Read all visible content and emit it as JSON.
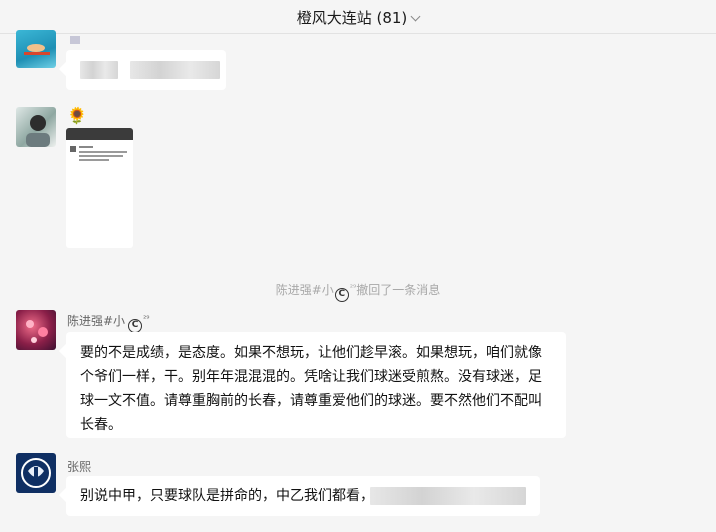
{
  "window": {
    "title": "橙风大连站 (81)"
  },
  "recall_notice": {
    "name": "陈进强#小",
    "superscript": "²⁹",
    "text": "撤回了一条消息"
  },
  "messages": [
    {
      "sender_name": "陈进强#小",
      "sender_superscript": "²⁹",
      "text": "要的不是成绩，是态度。如果不想玩，让他们趁早滚。如果想玩，咱们就像个爷们一样，干。别年年混混混的。凭啥让我们球迷受煎熬。没有球迷，足球一文不值。请尊重胸前的长春，请尊重爱他们的球迷。要不然他们不配叫长春。"
    },
    {
      "sender_name": "张熙",
      "text": "别说中甲，只要球队是拼命的，中乙我们都看，"
    }
  ],
  "image_message": {
    "emoji": "🌻"
  },
  "icons": {
    "dropdown": "chevron-down-icon",
    "copyright": "copyright-icon"
  },
  "colors": {
    "background": "#f5f5f5",
    "bubble": "#ffffff",
    "notice": "#a8a8a8"
  }
}
